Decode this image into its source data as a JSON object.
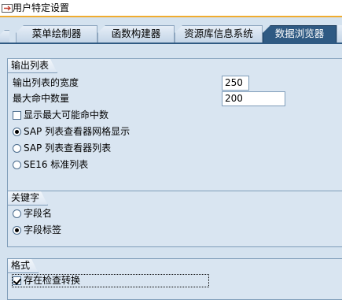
{
  "window": {
    "title": "用户特定设置",
    "accent": "#f0ac2f"
  },
  "tabs": [
    {
      "label": "菜单绘制器",
      "active": false
    },
    {
      "label": "函数构建器",
      "active": false
    },
    {
      "label": "资源库信息系统",
      "active": false
    },
    {
      "label": "数据浏览器",
      "active": true
    }
  ],
  "output_list": {
    "title": "输出列表",
    "width_label": "输出列表的宽度",
    "width_value": "250",
    "max_hits_label": "最大命中数量",
    "max_hits_value": "200",
    "show_max_hits_label": "显示最大可能命中数",
    "show_max_hits_checked": false,
    "radio_options": [
      {
        "label": "SAP 列表查看器网格显示",
        "checked": true
      },
      {
        "label": "SAP 列表查看器列表",
        "checked": false
      },
      {
        "label": "SE16 标准列表",
        "checked": false
      }
    ]
  },
  "keyword": {
    "title": "关键字",
    "radio_options": [
      {
        "label": "字段名",
        "checked": false
      },
      {
        "label": "字段标签",
        "checked": true
      }
    ]
  },
  "format": {
    "title": "格式",
    "check_conversion_label": "存在检查转换",
    "check_conversion_checked": true
  }
}
